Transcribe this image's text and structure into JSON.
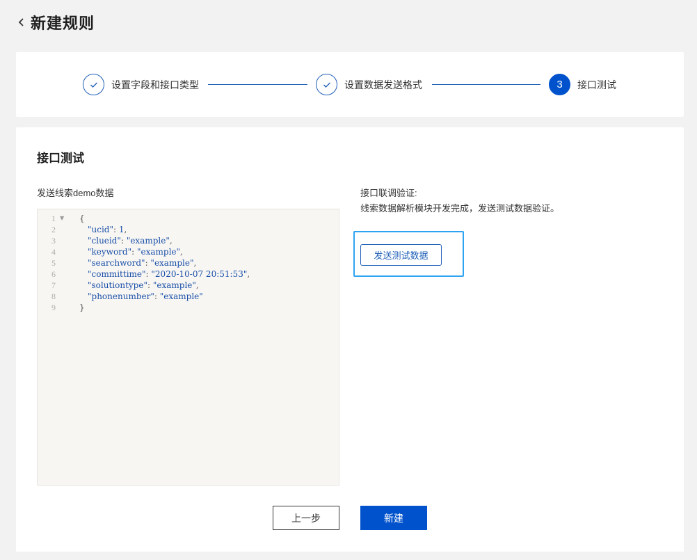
{
  "header": {
    "title": "新建规则"
  },
  "steps": [
    {
      "label": "设置字段和接口类型",
      "status": "done"
    },
    {
      "label": "设置数据发送格式",
      "status": "done"
    },
    {
      "label": "接口测试",
      "status": "active",
      "number": "3"
    }
  ],
  "main": {
    "section_title": "接口测试",
    "editor_label": "发送线索demo数据",
    "code_lines": [
      {
        "no": "1",
        "text": "{"
      },
      {
        "no": "2",
        "key": "\"ucid\"",
        "value": "1",
        "comma": ","
      },
      {
        "no": "3",
        "key": "\"clueid\"",
        "value": "\"example\"",
        "comma": ","
      },
      {
        "no": "4",
        "key": "\"keyword\"",
        "value": "\"example\"",
        "comma": ","
      },
      {
        "no": "5",
        "key": "\"searchword\"",
        "value": "\"example\"",
        "comma": ","
      },
      {
        "no": "6",
        "key": "\"committime\"",
        "value": "\"2020-10-07 20:51:53\"",
        "comma": ","
      },
      {
        "no": "7",
        "key": "\"solutiontype\"",
        "value": "\"example\"",
        "comma": ","
      },
      {
        "no": "8",
        "key": "\"phonenumber\"",
        "value": "\"example\"",
        "comma": ""
      },
      {
        "no": "9",
        "text": "}"
      }
    ],
    "verify_title": "接口联调验证:",
    "verify_desc": "线索数据解析模块开发完成，发送测试数据验证。",
    "send_button": "发送测试数据"
  },
  "footer": {
    "prev_label": "上一步",
    "create_label": "新建"
  },
  "colors": {
    "primary": "#0052cc",
    "highlight": "#2ea3f2",
    "background": "#f2f2f2"
  }
}
